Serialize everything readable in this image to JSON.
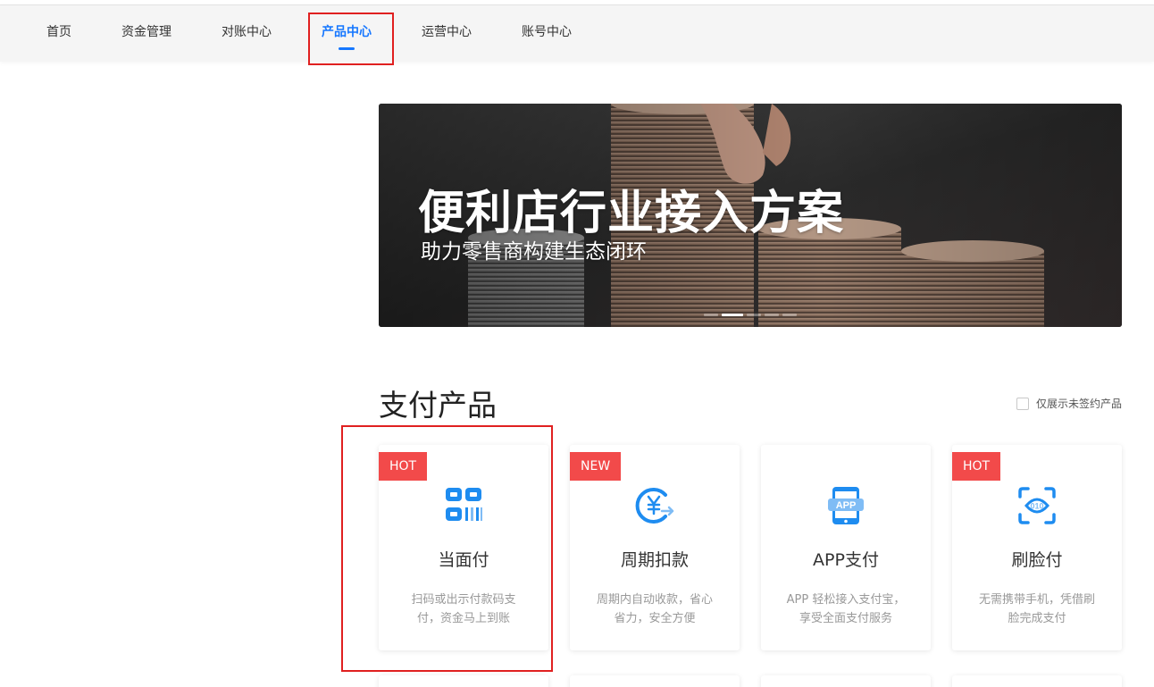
{
  "nav": {
    "items": [
      {
        "label": "首页"
      },
      {
        "label": "资金管理"
      },
      {
        "label": "对账中心"
      },
      {
        "label": "产品中心",
        "active": true
      },
      {
        "label": "运营中心"
      },
      {
        "label": "账号中心"
      }
    ]
  },
  "banner": {
    "title": "便利店行业接入方案",
    "subtitle": "助力零售商构建生态闭环",
    "slide_count": 5,
    "active_slide": 2
  },
  "section": {
    "title": "支付产品",
    "filter_label": "仅展示未签约产品",
    "filter_checked": false
  },
  "products": [
    {
      "badge": "HOT",
      "name": "当面付",
      "desc": "扫码或出示付款码支付，资金马上到账",
      "icon": "qr-scan-icon"
    },
    {
      "badge": "NEW",
      "name": "周期扣款",
      "desc": "周期内自动收款，省心省力，安全方便",
      "icon": "yen-cycle-icon"
    },
    {
      "badge": "",
      "name": "APP支付",
      "desc": "APP 轻松接入支付宝，享受全面支付服务",
      "icon": "app-phone-icon"
    },
    {
      "badge": "HOT",
      "name": "刷脸付",
      "desc": "无需携带手机，凭借刷脸完成支付",
      "icon": "face-scan-icon"
    }
  ],
  "colors": {
    "accent": "#1677ff",
    "badge": "#f24a4a",
    "icon": "#1e8cf0",
    "annotation": "#e02020"
  }
}
